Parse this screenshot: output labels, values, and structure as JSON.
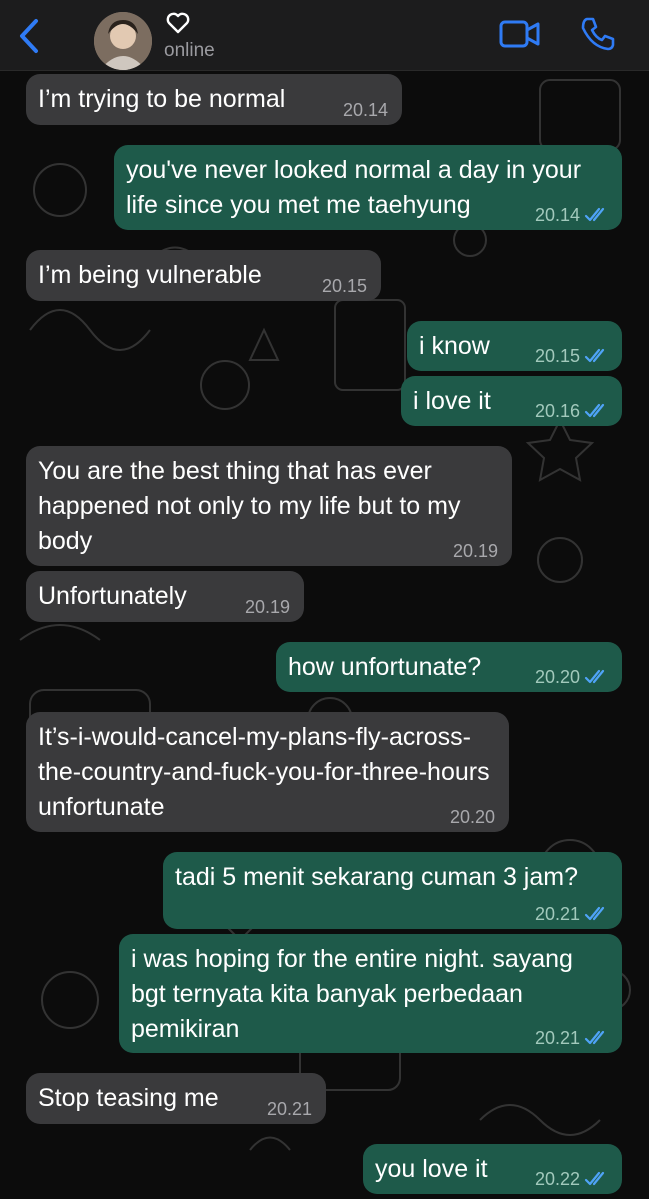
{
  "header": {
    "status": "online",
    "name_icon": "heart-outline-icon"
  },
  "colors": {
    "incoming_bubble": "#3a3a3c",
    "outgoing_bubble": "#1e5a4a",
    "accent": "#2f7bf5",
    "read_check": "#4fa3f7"
  },
  "messages": [
    {
      "direction": "in",
      "text": "I’m trying to be normal",
      "time": "20.14"
    },
    {
      "direction": "out",
      "text": "you've never looked normal a day in your life since you met me taehyung",
      "time": "20.14",
      "read": true
    },
    {
      "direction": "in",
      "text": "I’m being vulnerable",
      "time": "20.15"
    },
    {
      "direction": "out",
      "text": "i know",
      "time": "20.15",
      "read": true
    },
    {
      "direction": "out",
      "text": "i love it",
      "time": "20.16",
      "read": true
    },
    {
      "direction": "in",
      "text": "You are the best thing that has ever happened not only to my life but to my body",
      "time": "20.19"
    },
    {
      "direction": "in",
      "text": "Unfortunately",
      "time": "20.19"
    },
    {
      "direction": "out",
      "text": "how unfortunate?",
      "time": "20.20",
      "read": true
    },
    {
      "direction": "in",
      "text": "It’s-i-would-cancel-my-plans-fly-across-the-country-and-fuck-you-for-three-hours unfortunate",
      "time": "20.20"
    },
    {
      "direction": "out",
      "text": "tadi 5 menit sekarang cuman 3 jam?",
      "time": "20.21",
      "read": true
    },
    {
      "direction": "out",
      "text": "i was hoping for the entire night. sayang bgt ternyata kita banyak perbedaan pemikiran",
      "time": "20.21",
      "read": true
    },
    {
      "direction": "in",
      "text": "Stop teasing me",
      "time": "20.21"
    },
    {
      "direction": "out",
      "text": "you love it",
      "time": "20.22",
      "read": true
    }
  ]
}
